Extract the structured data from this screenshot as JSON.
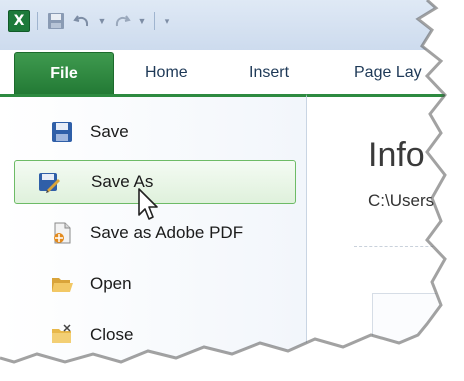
{
  "quick_access": {
    "app_icon_letter": "X"
  },
  "ribbon": {
    "tabs": [
      {
        "label": "File"
      },
      {
        "label": "Home"
      },
      {
        "label": "Insert"
      },
      {
        "label": "Page Lay"
      }
    ]
  },
  "backstage": {
    "menu": [
      {
        "label": "Save"
      },
      {
        "label": "Save As",
        "active": true
      },
      {
        "label": "Save as Adobe PDF"
      },
      {
        "label": "Open"
      },
      {
        "label": "Close"
      }
    ],
    "info": {
      "title": "Info",
      "path": "C:\\Users"
    }
  },
  "colors": {
    "file_tab": "#2d8a40",
    "active_item_border": "#6dbb66",
    "tab_text": "#1e3957"
  }
}
